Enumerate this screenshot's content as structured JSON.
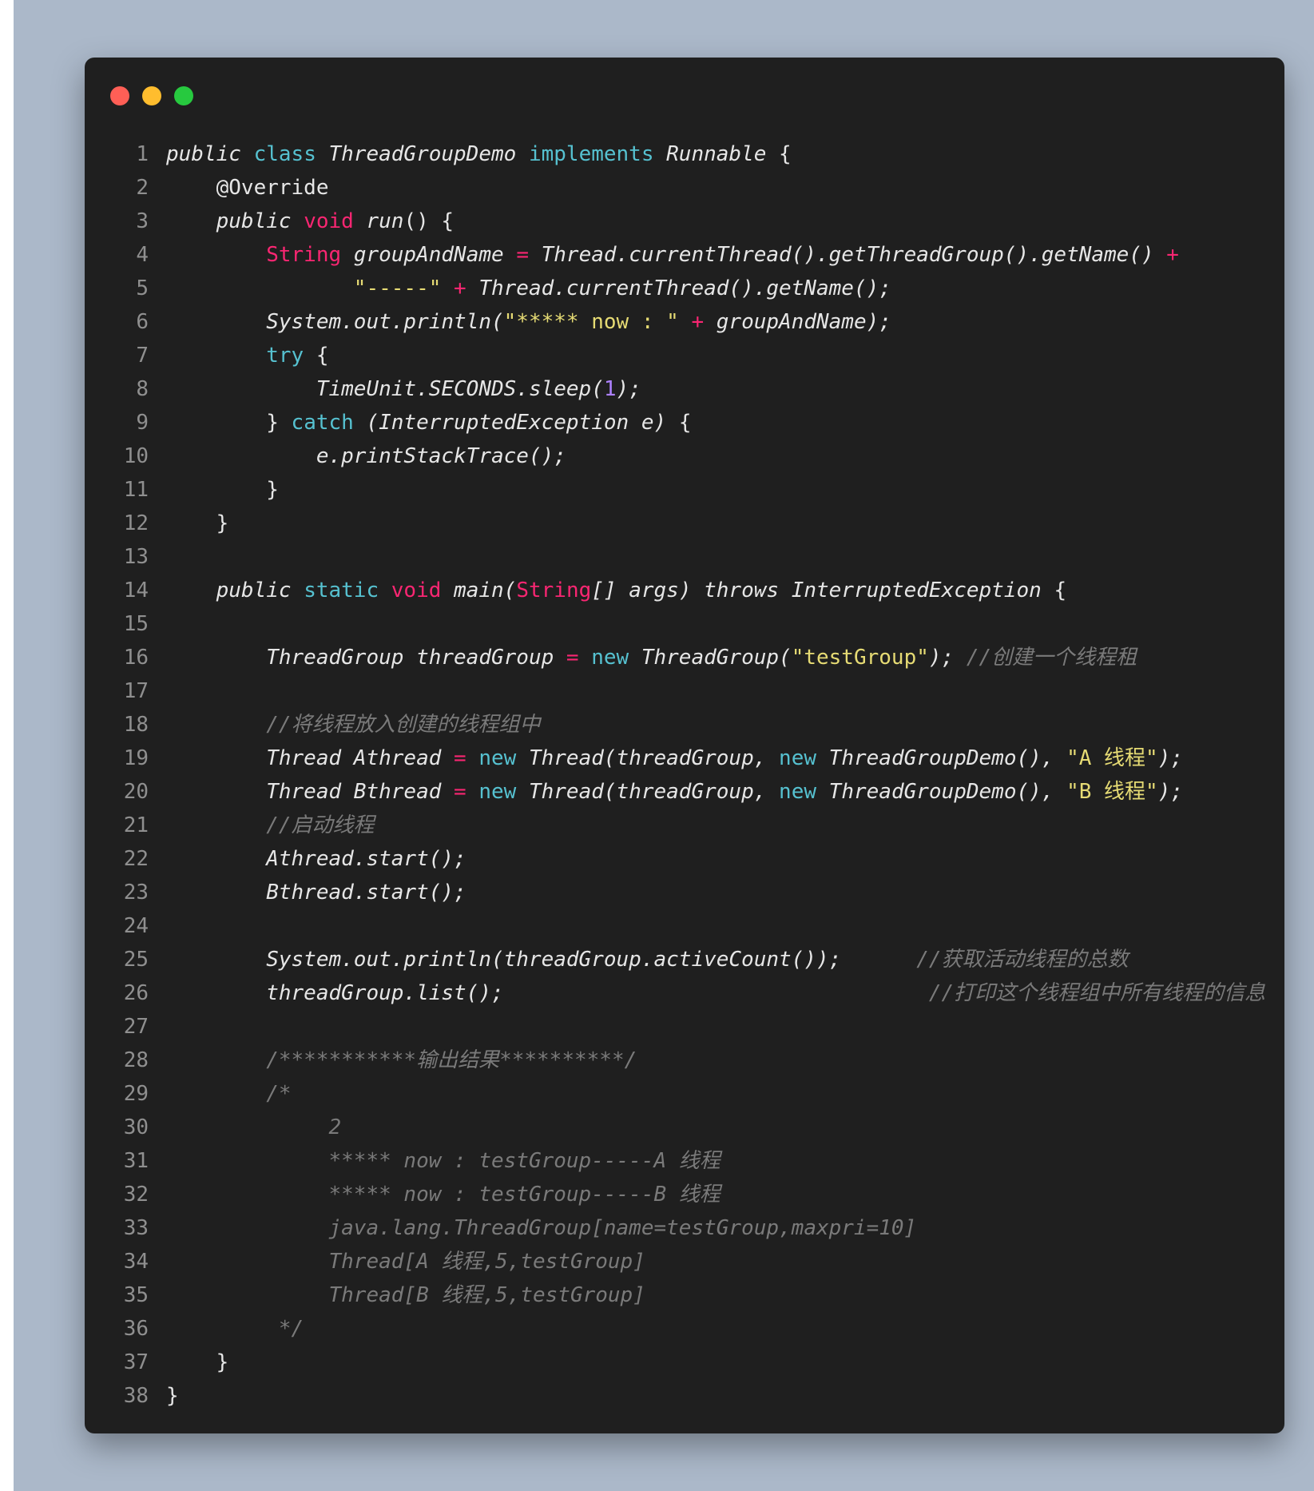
{
  "lines": [
    {
      "n": "1",
      "t": [
        {
          "c": "d",
          "v": "public "
        },
        {
          "c": "kw",
          "v": "class "
        },
        {
          "c": "d",
          "v": "ThreadGroupDemo "
        },
        {
          "c": "kw",
          "v": "implements "
        },
        {
          "c": "d",
          "v": "Runnable "
        },
        {
          "c": "n",
          "v": "{"
        }
      ]
    },
    {
      "n": "2",
      "t": [
        {
          "c": "n",
          "v": "    @Override"
        }
      ]
    },
    {
      "n": "3",
      "t": [
        {
          "c": "d",
          "v": "    public "
        },
        {
          "c": "kp",
          "v": "void "
        },
        {
          "c": "d",
          "v": "run"
        },
        {
          "c": "n",
          "v": "() {"
        }
      ]
    },
    {
      "n": "4",
      "t": [
        {
          "c": "kp",
          "v": "        String "
        },
        {
          "c": "d",
          "v": "groupAndName "
        },
        {
          "c": "kp",
          "v": "= "
        },
        {
          "c": "d",
          "v": "Thread.currentThread().getThreadGroup().getName() "
        },
        {
          "c": "kp",
          "v": "+"
        }
      ]
    },
    {
      "n": "5",
      "t": [
        {
          "c": "st",
          "v": "               \"-----\" "
        },
        {
          "c": "kp",
          "v": "+ "
        },
        {
          "c": "d",
          "v": "Thread.currentThread().getName();"
        }
      ]
    },
    {
      "n": "6",
      "t": [
        {
          "c": "d",
          "v": "        System.out.println("
        },
        {
          "c": "st",
          "v": "\"***** now : \" "
        },
        {
          "c": "kp",
          "v": "+ "
        },
        {
          "c": "d",
          "v": "groupAndName);"
        }
      ]
    },
    {
      "n": "7",
      "t": [
        {
          "c": "kw",
          "v": "        try "
        },
        {
          "c": "n",
          "v": "{"
        }
      ]
    },
    {
      "n": "8",
      "t": [
        {
          "c": "d",
          "v": "            TimeUnit.SECONDS.sleep("
        },
        {
          "c": "nu",
          "v": "1"
        },
        {
          "c": "d",
          "v": ");"
        }
      ]
    },
    {
      "n": "9",
      "t": [
        {
          "c": "n",
          "v": "        } "
        },
        {
          "c": "kw",
          "v": "catch "
        },
        {
          "c": "d",
          "v": "(InterruptedException e) "
        },
        {
          "c": "n",
          "v": "{"
        }
      ]
    },
    {
      "n": "10",
      "t": [
        {
          "c": "d",
          "v": "            e.printStackTrace();"
        }
      ]
    },
    {
      "n": "11",
      "t": [
        {
          "c": "n",
          "v": "        }"
        }
      ]
    },
    {
      "n": "12",
      "t": [
        {
          "c": "n",
          "v": "    }"
        }
      ]
    },
    {
      "n": "13",
      "t": []
    },
    {
      "n": "14",
      "t": [
        {
          "c": "d",
          "v": "    public "
        },
        {
          "c": "kw",
          "v": "static "
        },
        {
          "c": "kp",
          "v": "void "
        },
        {
          "c": "d",
          "v": "main("
        },
        {
          "c": "kp",
          "v": "String"
        },
        {
          "c": "d",
          "v": "[] args) throws InterruptedException "
        },
        {
          "c": "n",
          "v": "{"
        }
      ]
    },
    {
      "n": "15",
      "t": []
    },
    {
      "n": "16",
      "t": [
        {
          "c": "d",
          "v": "        ThreadGroup threadGroup "
        },
        {
          "c": "kp",
          "v": "= "
        },
        {
          "c": "kw",
          "v": "new "
        },
        {
          "c": "d",
          "v": "ThreadGroup("
        },
        {
          "c": "st",
          "v": "\"testGroup\""
        },
        {
          "c": "d",
          "v": "); "
        },
        {
          "c": "cm",
          "v": "//创建一个线程租"
        }
      ]
    },
    {
      "n": "17",
      "t": []
    },
    {
      "n": "18",
      "t": [
        {
          "c": "cm",
          "v": "        //将线程放入创建的线程组中"
        }
      ]
    },
    {
      "n": "19",
      "t": [
        {
          "c": "d",
          "v": "        Thread Athread "
        },
        {
          "c": "kp",
          "v": "= "
        },
        {
          "c": "kw",
          "v": "new "
        },
        {
          "c": "d",
          "v": "Thread(threadGroup, "
        },
        {
          "c": "kw",
          "v": "new "
        },
        {
          "c": "d",
          "v": "ThreadGroupDemo(), "
        },
        {
          "c": "st",
          "v": "\"A 线程\""
        },
        {
          "c": "d",
          "v": ");"
        }
      ]
    },
    {
      "n": "20",
      "t": [
        {
          "c": "d",
          "v": "        Thread Bthread "
        },
        {
          "c": "kp",
          "v": "= "
        },
        {
          "c": "kw",
          "v": "new "
        },
        {
          "c": "d",
          "v": "Thread(threadGroup, "
        },
        {
          "c": "kw",
          "v": "new "
        },
        {
          "c": "d",
          "v": "ThreadGroupDemo(), "
        },
        {
          "c": "st",
          "v": "\"B 线程\""
        },
        {
          "c": "d",
          "v": ");"
        }
      ]
    },
    {
      "n": "21",
      "t": [
        {
          "c": "cm",
          "v": "        //启动线程"
        }
      ]
    },
    {
      "n": "22",
      "t": [
        {
          "c": "d",
          "v": "        Athread.start();"
        }
      ]
    },
    {
      "n": "23",
      "t": [
        {
          "c": "d",
          "v": "        Bthread.start();"
        }
      ]
    },
    {
      "n": "24",
      "t": []
    },
    {
      "n": "25",
      "t": [
        {
          "c": "d",
          "v": "        System.out.println(threadGroup.activeCount());      "
        },
        {
          "c": "cm",
          "v": "//获取活动线程的总数"
        }
      ]
    },
    {
      "n": "26",
      "t": [
        {
          "c": "d",
          "v": "        threadGroup.list();                                  "
        },
        {
          "c": "cm",
          "v": "//打印这个线程组中所有线程的信息"
        }
      ]
    },
    {
      "n": "27",
      "t": []
    },
    {
      "n": "28",
      "t": [
        {
          "c": "cm",
          "v": "        /***********输出结果**********/"
        }
      ]
    },
    {
      "n": "29",
      "t": [
        {
          "c": "cm",
          "v": "        /*"
        }
      ]
    },
    {
      "n": "30",
      "t": [
        {
          "c": "cm",
          "v": "             2"
        }
      ]
    },
    {
      "n": "31",
      "t": [
        {
          "c": "cm",
          "v": "             ***** now : testGroup-----A 线程"
        }
      ]
    },
    {
      "n": "32",
      "t": [
        {
          "c": "cm",
          "v": "             ***** now : testGroup-----B 线程"
        }
      ]
    },
    {
      "n": "33",
      "t": [
        {
          "c": "cm",
          "v": "             java.lang.ThreadGroup[name=testGroup,maxpri=10]"
        }
      ]
    },
    {
      "n": "34",
      "t": [
        {
          "c": "cm",
          "v": "             Thread[A 线程,5,testGroup]"
        }
      ]
    },
    {
      "n": "35",
      "t": [
        {
          "c": "cm",
          "v": "             Thread[B 线程,5,testGroup]"
        }
      ]
    },
    {
      "n": "36",
      "t": [
        {
          "c": "cm",
          "v": "         */"
        }
      ]
    },
    {
      "n": "37",
      "t": [
        {
          "c": "n",
          "v": "    }"
        }
      ]
    },
    {
      "n": "38",
      "t": [
        {
          "c": "n",
          "v": "}"
        }
      ]
    }
  ]
}
